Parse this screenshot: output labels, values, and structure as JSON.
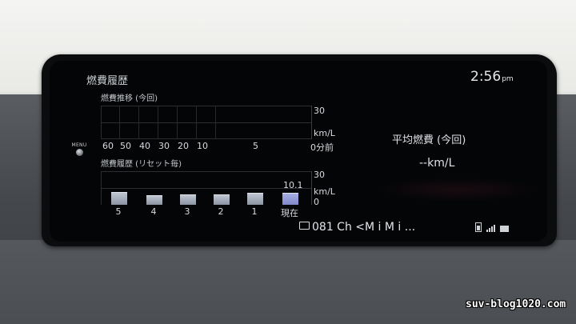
{
  "screen": {
    "title": "燃費履歴",
    "clock": {
      "time": "2:56",
      "ampm": "pm"
    },
    "menu_label": "MENU"
  },
  "trend": {
    "label": "燃費推移 (今回)",
    "y_max": "30",
    "unit": "km/L",
    "x_ticks": [
      "60",
      "50",
      "40",
      "30",
      "20",
      "10",
      "5",
      "0分前"
    ]
  },
  "history": {
    "label": "燃費履歴 (リセット毎)",
    "y_max": "30",
    "unit": "km/L",
    "y_min": "0",
    "current_value_label": "10.1",
    "categories": [
      "5",
      "4",
      "3",
      "2",
      "1",
      "現在"
    ]
  },
  "chart_data": {
    "type": "bar",
    "categories": [
      "5",
      "4",
      "3",
      "2",
      "1",
      "現在"
    ],
    "values": [
      10.5,
      8.2,
      8.5,
      8.8,
      9.8,
      10.1
    ],
    "ylabel": "km/L",
    "ylim": [
      0,
      30
    ]
  },
  "average": {
    "label": "平均燃費 (今回)",
    "value": "--km/L"
  },
  "status_bar": {
    "source_text": "081 Ch <M i M i ...",
    "icons": [
      "tv-icon",
      "battery-icon",
      "signal-icon",
      "message-icon"
    ]
  },
  "watermark": "suv-blog1020.com"
}
